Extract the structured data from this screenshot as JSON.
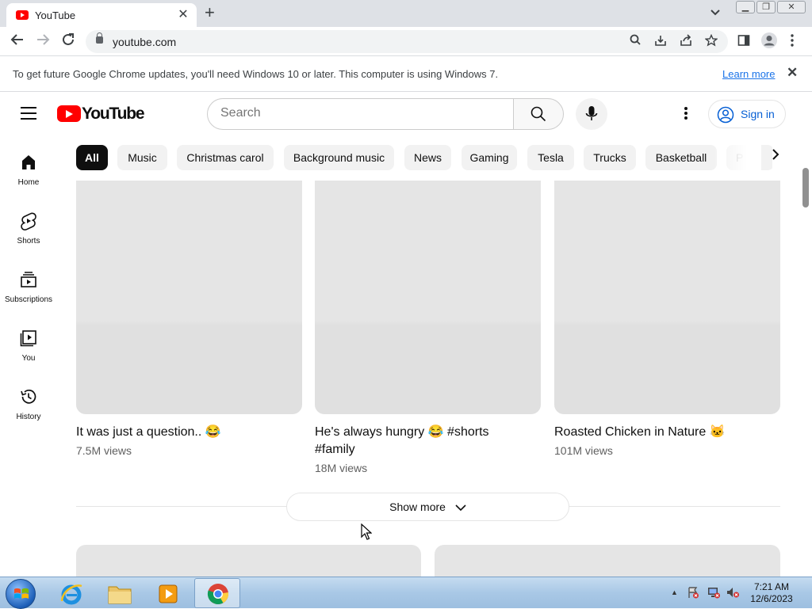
{
  "browser": {
    "tab_title": "YouTube",
    "url": "youtube.com",
    "new_tab_label": "+",
    "tab_close_label": "✕"
  },
  "infobar": {
    "message": "To get future Google Chrome updates, you'll need Windows 10 or later. This computer is using Windows 7.",
    "link_label": "Learn more",
    "close_label": "✕"
  },
  "youtube": {
    "logo_text": "YouTube",
    "search_placeholder": "Search",
    "signin_label": "Sign in",
    "sidebar": [
      {
        "label": "Home",
        "icon": "home-icon"
      },
      {
        "label": "Shorts",
        "icon": "shorts-icon"
      },
      {
        "label": "Subscriptions",
        "icon": "subscriptions-icon"
      },
      {
        "label": "You",
        "icon": "you-icon"
      },
      {
        "label": "History",
        "icon": "history-icon"
      }
    ],
    "chips": [
      "All",
      "Music",
      "Christmas carol",
      "Background music",
      "News",
      "Gaming",
      "Tesla",
      "Trucks",
      "Basketball",
      "P"
    ],
    "active_chip": "All",
    "videos": [
      {
        "title": "It was just a question.. 😂",
        "views": "7.5M views"
      },
      {
        "title": "He's always hungry 😂 #shorts #family",
        "views": "18M views"
      },
      {
        "title": "Roasted Chicken in Nature 🐱",
        "views": "101M views"
      }
    ],
    "show_more_label": "Show more"
  },
  "taskbar": {
    "time": "7:21 AM",
    "date": "12/6/2023",
    "tray_expand_label": "▲"
  },
  "colors": {
    "youtube_red": "#ff0000",
    "link_blue": "#065fd4",
    "chip_active": "#0f0f0f"
  }
}
